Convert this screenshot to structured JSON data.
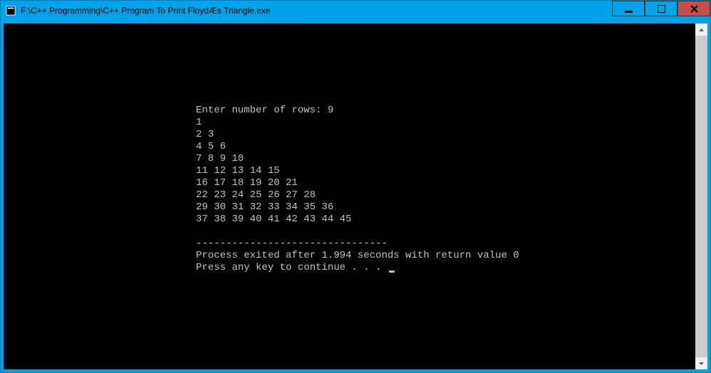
{
  "window": {
    "title": "F:\\C++ Programming\\C++ Program To Print FloydÆs Triangle.exe"
  },
  "console": {
    "prompt": "Enter number of rows: 9",
    "rows": [
      "1",
      "2 3",
      "4 5 6",
      "7 8 9 10",
      "11 12 13 14 15",
      "16 17 18 19 20 21",
      "22 23 24 25 26 27 28",
      "29 30 31 32 33 34 35 36",
      "37 38 39 40 41 42 43 44 45"
    ],
    "divider": "--------------------------------",
    "exit_msg": "Process exited after 1.994 seconds with return value 0",
    "continue_msg": "Press any key to continue . . . "
  }
}
